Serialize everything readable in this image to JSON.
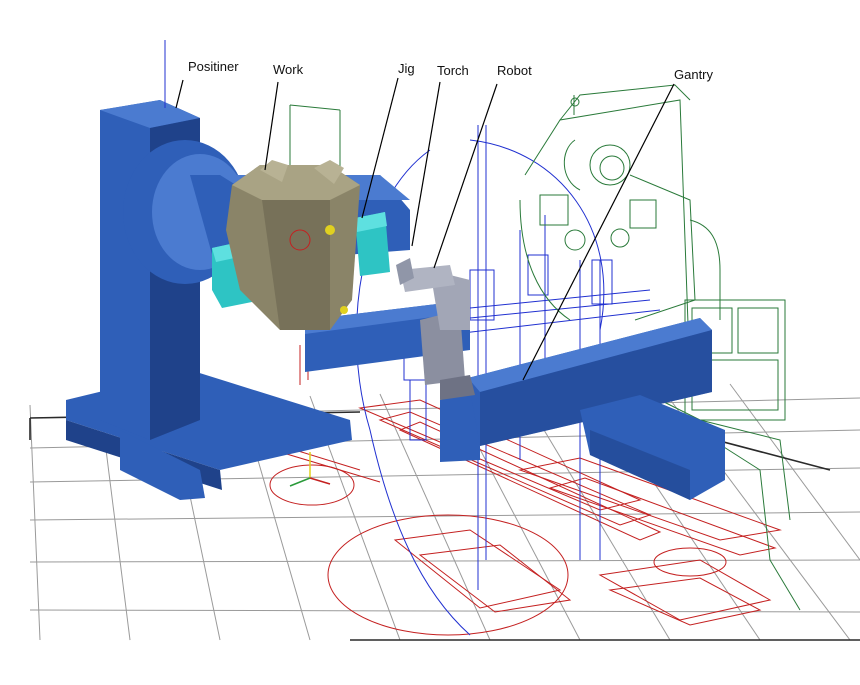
{
  "labels": {
    "positioner": "Positiner",
    "work": "Work",
    "jig": "Jig",
    "torch": "Torch",
    "robot": "Robot",
    "gantry": "Gantry"
  },
  "colors": {
    "background": "#ffffff",
    "grid": "#9a9a9a",
    "grid_major": "#2a2a2a",
    "positioner": "#2f5fb8",
    "positioner_dark": "#1f428a",
    "positioner_light": "#4b7bd0",
    "jig": "#2ec4c4",
    "work": "#8a8468",
    "gantry": "#2f5fb8",
    "robot": "#8b8fa0",
    "wireframe_red": "#c42020",
    "wireframe_blue": "#2030d0",
    "wireframe_green": "#2a7a3a",
    "leader_line": "#000000"
  }
}
